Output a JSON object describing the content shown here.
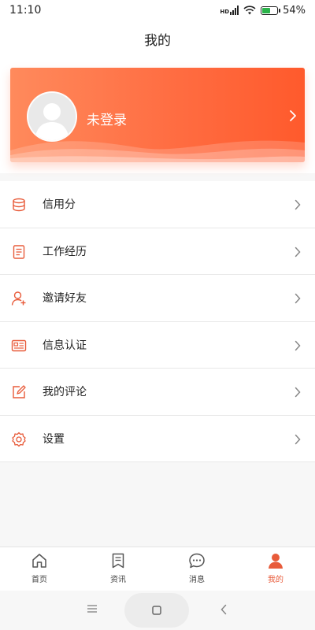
{
  "status_bar": {
    "time": "11:10",
    "battery": "54%",
    "network": "HD"
  },
  "header": {
    "title": "我的"
  },
  "profile": {
    "login_label": "未登录"
  },
  "menu": {
    "items": [
      {
        "label": "信用分",
        "icon": "database-icon"
      },
      {
        "label": "工作经历",
        "icon": "document-icon"
      },
      {
        "label": "邀请好友",
        "icon": "add-user-icon"
      },
      {
        "label": "信息认证",
        "icon": "id-card-icon"
      },
      {
        "label": "我的评论",
        "icon": "edit-icon"
      },
      {
        "label": "设置",
        "icon": "gear-icon"
      }
    ]
  },
  "bottom_nav": {
    "items": [
      {
        "label": "首页",
        "icon": "home-icon"
      },
      {
        "label": "资讯",
        "icon": "bookmark-icon"
      },
      {
        "label": "消息",
        "icon": "chat-bubble-icon"
      },
      {
        "label": "我的",
        "icon": "user-icon",
        "active": true
      }
    ]
  },
  "colors": {
    "accent": "#e85b3a",
    "card_start": "#ff8a5c",
    "card_end": "#ff5a2c"
  }
}
